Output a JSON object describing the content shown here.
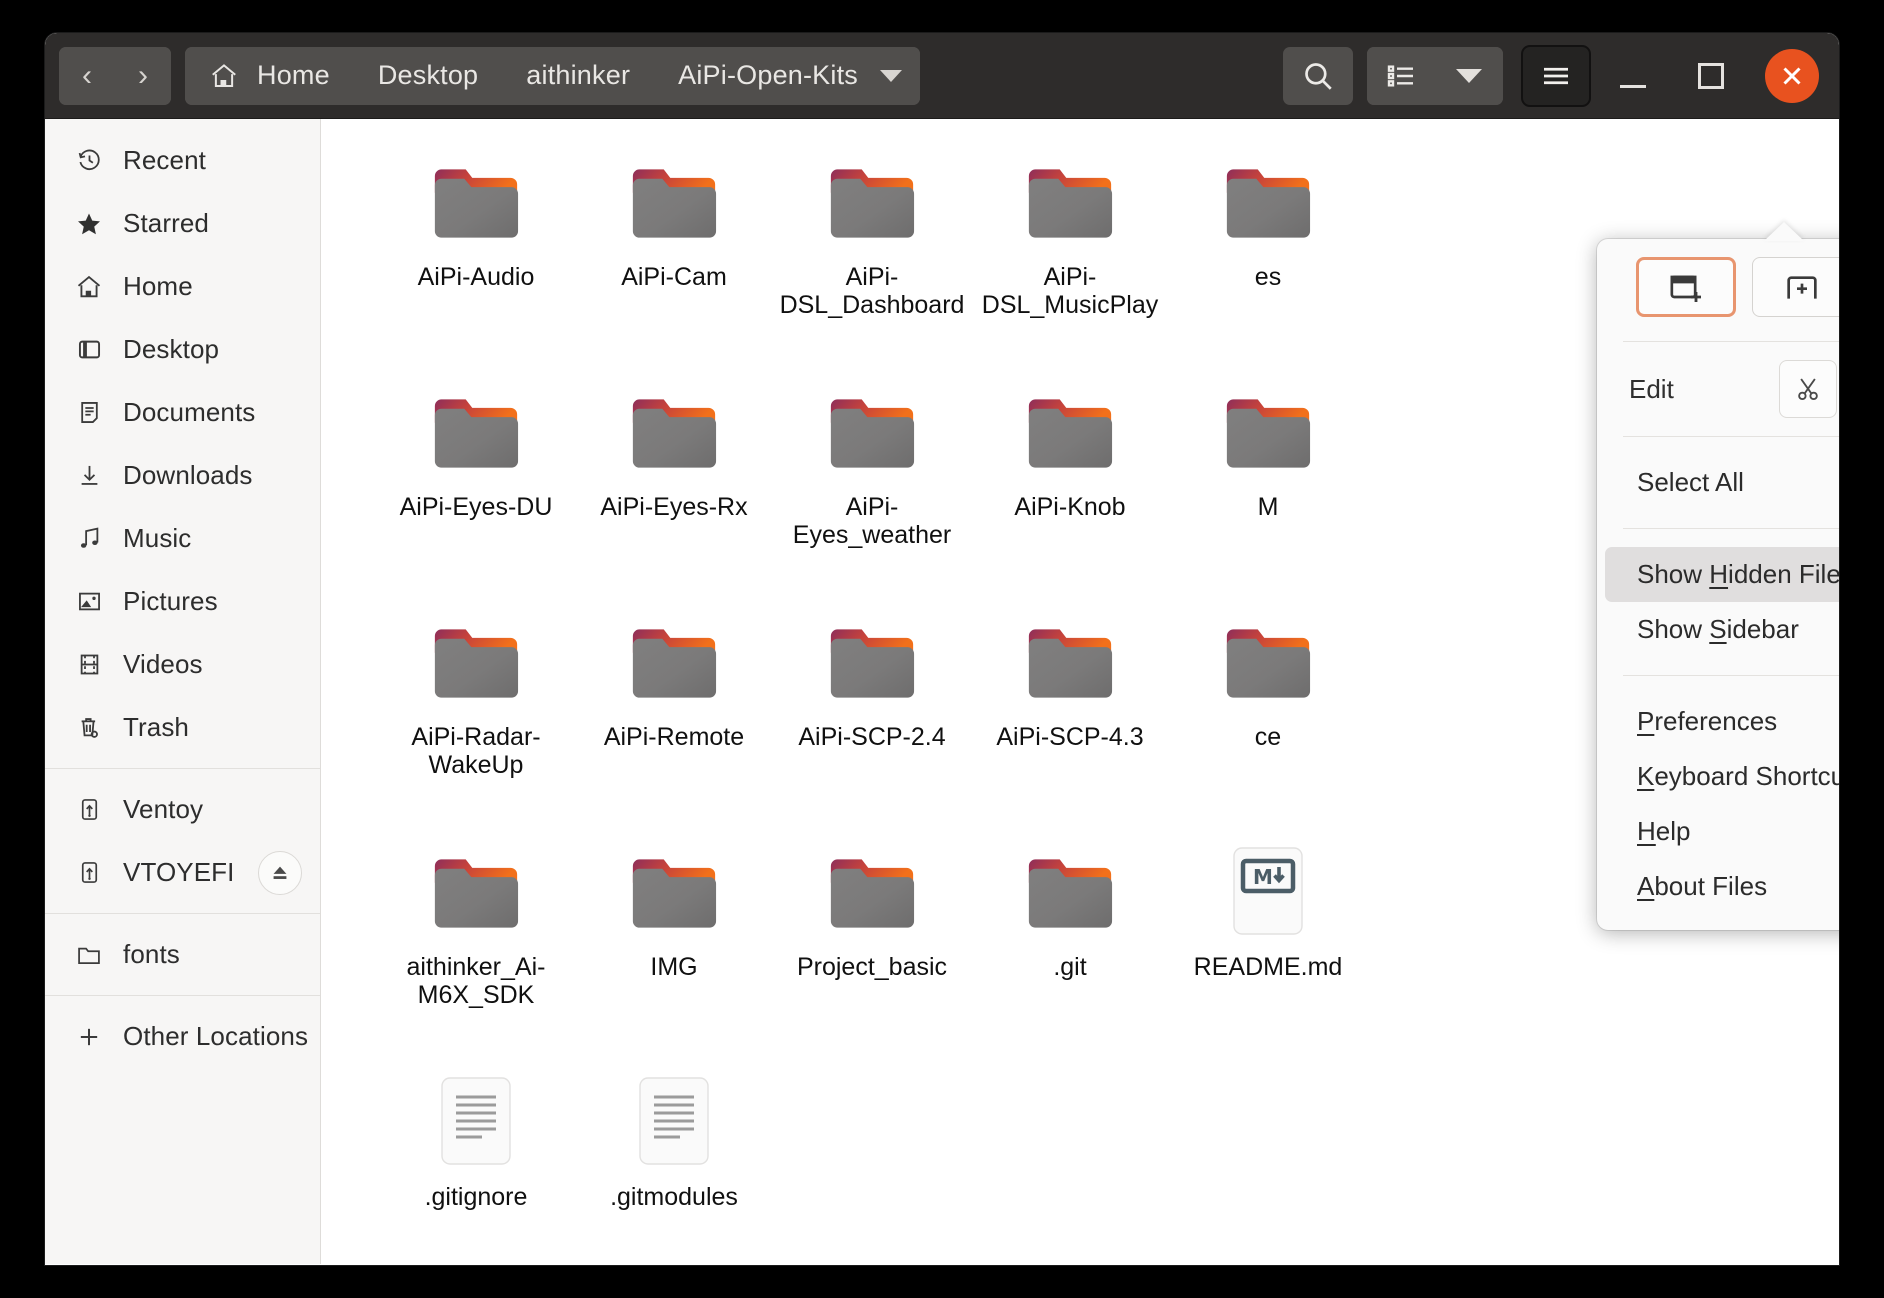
{
  "window": {
    "nav": {
      "back": "‹",
      "forward": "›"
    },
    "breadcrumbs": [
      {
        "label": "Home",
        "icon": "home-icon"
      },
      {
        "label": "Desktop",
        "icon": null
      },
      {
        "label": "aithinker",
        "icon": null
      },
      {
        "label": "AiPi-Open-Kits",
        "icon": null,
        "current": true
      }
    ],
    "toolbar": {
      "search": "search-icon",
      "view_list": "list-view-icon",
      "view_dropdown": "chevron-down-icon",
      "menu": "hamburger-menu-icon",
      "minimize": "minimize-icon",
      "maximize": "maximize-icon",
      "close": "close-icon"
    }
  },
  "sidebar": {
    "items": [
      {
        "label": "Recent",
        "icon": "clock-icon"
      },
      {
        "label": "Starred",
        "icon": "star-icon"
      },
      {
        "label": "Home",
        "icon": "home-icon"
      },
      {
        "label": "Desktop",
        "icon": "desktop-icon"
      },
      {
        "label": "Documents",
        "icon": "document-icon"
      },
      {
        "label": "Downloads",
        "icon": "download-icon"
      },
      {
        "label": "Music",
        "icon": "music-note-icon"
      },
      {
        "label": "Pictures",
        "icon": "picture-icon"
      },
      {
        "label": "Videos",
        "icon": "film-icon"
      },
      {
        "label": "Trash",
        "icon": "trash-icon"
      }
    ],
    "devices": [
      {
        "label": "Ventoy",
        "icon": "usb-drive-icon",
        "eject": false
      },
      {
        "label": "VTOYEFI",
        "icon": "usb-drive-icon",
        "eject": true
      }
    ],
    "bookmarks": [
      {
        "label": "fonts",
        "icon": "folder-outline-icon"
      }
    ],
    "other": {
      "label": "Other Locations",
      "icon": "plus-icon"
    }
  },
  "files": [
    {
      "name": "AiPi-Audio",
      "type": "folder"
    },
    {
      "name": "AiPi-Cam",
      "type": "folder"
    },
    {
      "name": "AiPi-DSL_Dashboard",
      "type": "folder"
    },
    {
      "name": "AiPi-DSL_MusicPlay",
      "type": "folder"
    },
    {
      "name": "es",
      "type": "folder",
      "occluded": true
    },
    {
      "name": "AiPi-Eyes-DU",
      "type": "folder"
    },
    {
      "name": "AiPi-Eyes-Rx",
      "type": "folder"
    },
    {
      "name": "AiPi-Eyes_weather",
      "type": "folder"
    },
    {
      "name": "AiPi-Knob",
      "type": "folder"
    },
    {
      "name": "M",
      "type": "folder",
      "occluded": true
    },
    {
      "name": "AiPi-Radar-WakeUp",
      "type": "folder"
    },
    {
      "name": "AiPi-Remote",
      "type": "folder"
    },
    {
      "name": "AiPi-SCP-2.4",
      "type": "folder"
    },
    {
      "name": "AiPi-SCP-4.3",
      "type": "folder"
    },
    {
      "name": "ce",
      "type": "folder",
      "occluded": true
    },
    {
      "name": "aithinker_Ai-M6X_SDK",
      "type": "folder"
    },
    {
      "name": "IMG",
      "type": "folder"
    },
    {
      "name": "Project_basic",
      "type": "folder"
    },
    {
      "name": ".git",
      "type": "folder"
    },
    {
      "name": "README.md",
      "type": "markdown"
    },
    {
      "name": ".gitignore",
      "type": "text"
    },
    {
      "name": ".gitmodules",
      "type": "text"
    }
  ],
  "menu": {
    "top_buttons": [
      {
        "name": "new-window-button",
        "icon": "new-window-icon",
        "focused": true
      },
      {
        "name": "new-tab-button",
        "icon": "new-tab-icon",
        "focused": false
      },
      {
        "name": "new-folder-button",
        "icon": "new-folder-icon",
        "focused": false
      }
    ],
    "edit": {
      "label": "Edit",
      "buttons": [
        {
          "name": "cut-button",
          "icon": "scissors-icon"
        },
        {
          "name": "copy-button",
          "icon": "copy-icon"
        },
        {
          "name": "paste-button",
          "icon": "clipboard-icon"
        }
      ]
    },
    "select_all": {
      "label": "Select All"
    },
    "toggles": [
      {
        "prefix": "Show ",
        "mnemonic": "H",
        "suffix": "idden Files",
        "checked": true,
        "hovered": true
      },
      {
        "prefix": "Show ",
        "mnemonic": "S",
        "suffix": "idebar",
        "checked": true,
        "hovered": false
      }
    ],
    "links": [
      {
        "prefix": "",
        "mnemonic": "P",
        "suffix": "references"
      },
      {
        "prefix": "",
        "mnemonic": "K",
        "suffix": "eyboard Shortcuts"
      },
      {
        "prefix": "",
        "mnemonic": "H",
        "suffix": "elp"
      },
      {
        "prefix": "",
        "mnemonic": "A",
        "suffix": "bout Files"
      }
    ]
  },
  "colors": {
    "headerbar": "#2e2c2b",
    "button": "#504e4c",
    "close": "#e8521f",
    "sidebar": "#f7f6f5",
    "checkbox": "#9c4f96",
    "checkbox_hover": "#b367ac",
    "focus_ring": "#e8956f",
    "folder_body": "#7c7b7b",
    "folder_tab_start": "#8e2e5a",
    "folder_tab_end": "#ef6c1a"
  }
}
